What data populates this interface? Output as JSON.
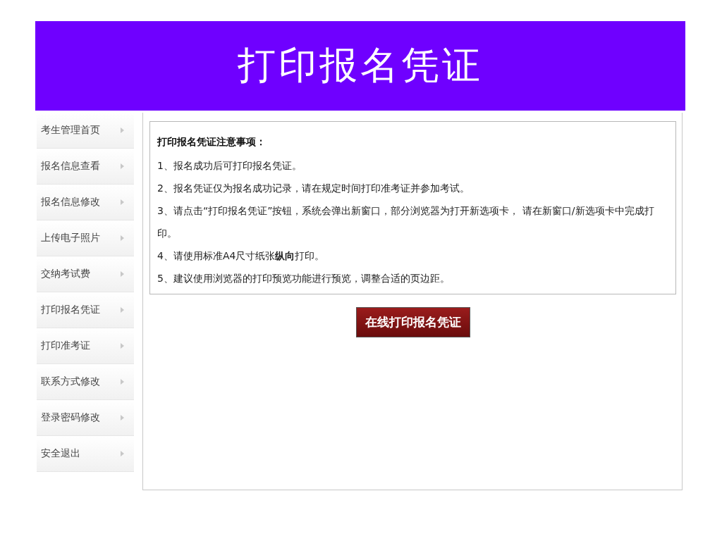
{
  "header": {
    "title": "打印报名凭证"
  },
  "sidebar": {
    "items": [
      {
        "label": "考生管理首页"
      },
      {
        "label": "报名信息查看"
      },
      {
        "label": "报名信息修改"
      },
      {
        "label": "上传电子照片"
      },
      {
        "label": "交纳考试费"
      },
      {
        "label": "打印报名凭证"
      },
      {
        "label": "打印准考证"
      },
      {
        "label": "联系方式修改"
      },
      {
        "label": "登录密码修改"
      },
      {
        "label": "安全退出"
      }
    ]
  },
  "notice": {
    "heading": "打印报名凭证注意事项：",
    "lines": [
      "1、报名成功后可打印报名凭证。",
      "2、报名凭证仅为报名成功记录，请在规定时间打印准考证并参加考试。",
      "3、请点击“打印报名凭证”按钮，系统会弹出新窗口，部分浏览器为打开新选项卡， 请在新窗口/新选项卡中完成打印。",
      "4、请使用标准A4尺寸纸张**纵向**打印。",
      "5、建议使用浏览器的打印预览功能进行预览，调整合适的页边距。"
    ]
  },
  "button": {
    "label": "在线打印报名凭证"
  }
}
